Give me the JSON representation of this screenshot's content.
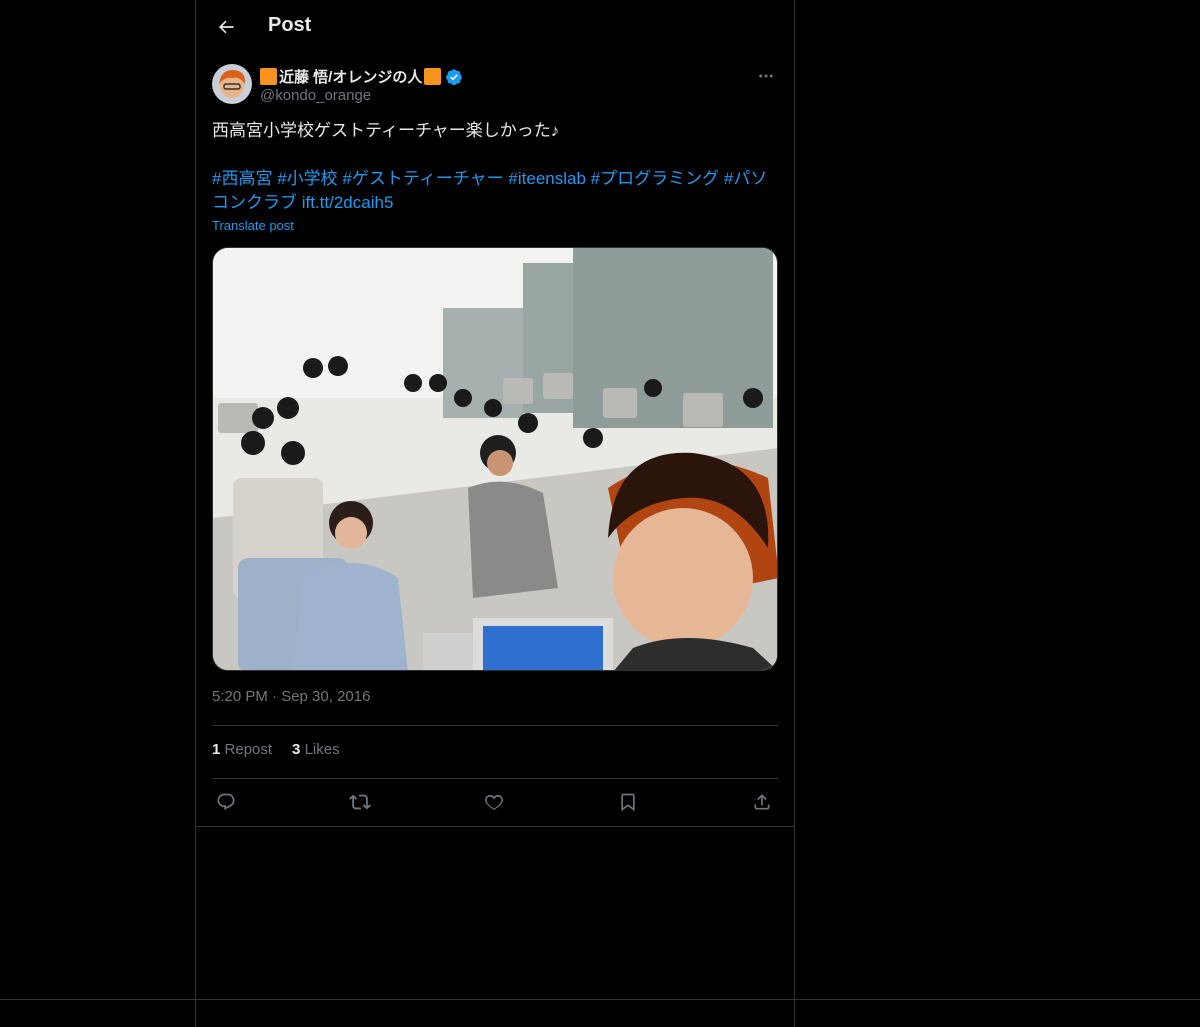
{
  "header": {
    "title": "Post"
  },
  "author": {
    "name": "近藤 悟/オレンジの人",
    "handle": "@kondo_orange",
    "verified": true
  },
  "post": {
    "text": "西高宮小学校ゲストティーチャー楽しかった♪",
    "tags": [
      "#西高宮",
      "#小学校",
      "#ゲストティーチャー",
      "#iteenslab",
      "#プログラミング",
      "#パソコンクラブ"
    ],
    "link": "ift.tt/2dcaih5",
    "translate_label": "Translate post",
    "timestamp": "5:20 PM · Sep 30, 2016"
  },
  "stats": {
    "reposts_count": "1",
    "reposts_label": "Repost",
    "likes_count": "3",
    "likes_label": "Likes"
  },
  "icons": {
    "back": "arrow-left-icon",
    "more": "more-horizontal-icon",
    "reply": "reply-icon",
    "repost": "repost-icon",
    "like": "heart-icon",
    "bookmark": "bookmark-icon",
    "share": "share-icon"
  },
  "colors": {
    "accent": "#1d9bf0",
    "brand_square": "#f7941d",
    "muted": "#71767b"
  }
}
